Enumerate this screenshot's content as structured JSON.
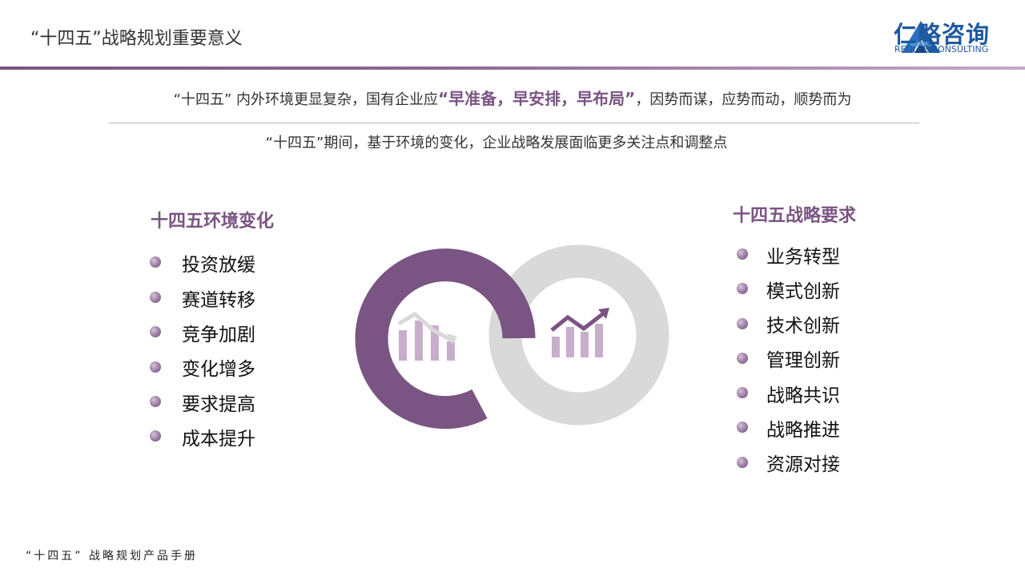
{
  "header": {
    "title": "“十四五”战略规划重要意义",
    "logo_name": "仁略咨询",
    "logo_sub": "RENLEE CONSULTING"
  },
  "headline": {
    "prefix": "“十四五” 内外环境更显复杂，国有企业应",
    "emphasis": "“早准备，早安排，早布局”",
    "suffix": "，因势而谋，应势而动，顺势而为"
  },
  "subline": "“十四五”期间，基于环境的变化，企业战略发展面临更多关注点和调整点",
  "left": {
    "title": "十四五环境变化",
    "items": [
      "投资放缓",
      "赛道转移",
      "竞争加剧",
      "变化增多",
      "要求提高",
      "成本提升"
    ]
  },
  "right": {
    "title": "十四五战略要求",
    "items": [
      "业务转型",
      "模式创新",
      "技术创新",
      "管理创新",
      "战略共识",
      "战略推进",
      "资源对接"
    ]
  },
  "icons": {
    "left_ring_icon": "decline-chart-icon",
    "right_ring_icon": "growth-chart-icon"
  },
  "colors": {
    "accent": "#7a5482",
    "ring_grey": "#d9d9d9",
    "logo_blue": "#1f5aa0"
  },
  "footer": "“十四五” 战略规划产品手册"
}
